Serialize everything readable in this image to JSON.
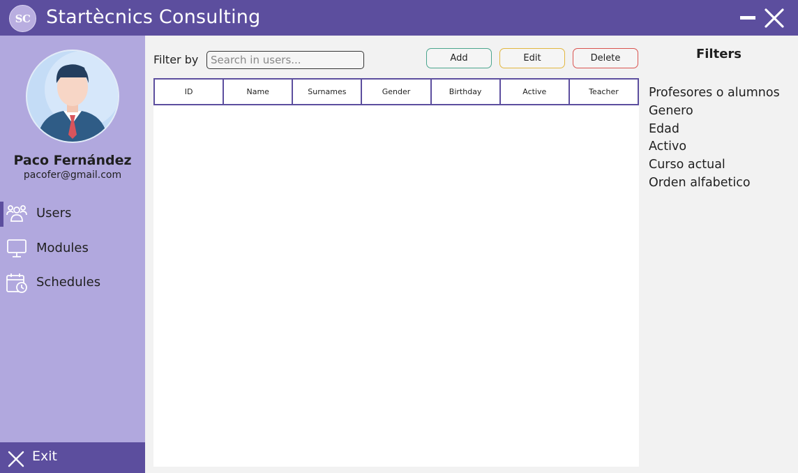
{
  "titlebar": {
    "logo_text": "SC",
    "title": "Startècnics Consulting",
    "minimize_icon": "minimize-icon",
    "close_icon": "close-icon"
  },
  "sidebar": {
    "user": {
      "name": "Paco Fernández",
      "email": "pacofer@gmail.com",
      "avatar_icon": "user-avatar"
    },
    "items": [
      {
        "label": "Users",
        "icon": "users-icon",
        "active": true
      },
      {
        "label": "Modules",
        "icon": "monitor-icon",
        "active": false
      },
      {
        "label": "Schedules",
        "icon": "calendar-clock-icon",
        "active": false
      }
    ],
    "exit_label": "Exit"
  },
  "toolbar": {
    "filter_label": "Filter by",
    "search_placeholder": "Search in users...",
    "add_label": "Add",
    "edit_label": "Edit",
    "delete_label": "Delete"
  },
  "table": {
    "columns": [
      "ID",
      "Name",
      "Surnames",
      "Gender",
      "Birthday",
      "Active",
      "Teacher"
    ],
    "rows": []
  },
  "filters": {
    "title": "Filters",
    "items": [
      "Profesores o alumnos",
      "Genero",
      "Edad",
      "Activo",
      "Curso actual",
      "Orden alfabetico"
    ]
  },
  "colors": {
    "primary": "#5c4e9e",
    "sidebar": "#b1a8de",
    "add_border": "#4aa58d",
    "edit_border": "#e2b63f",
    "delete_border": "#d9534f"
  }
}
